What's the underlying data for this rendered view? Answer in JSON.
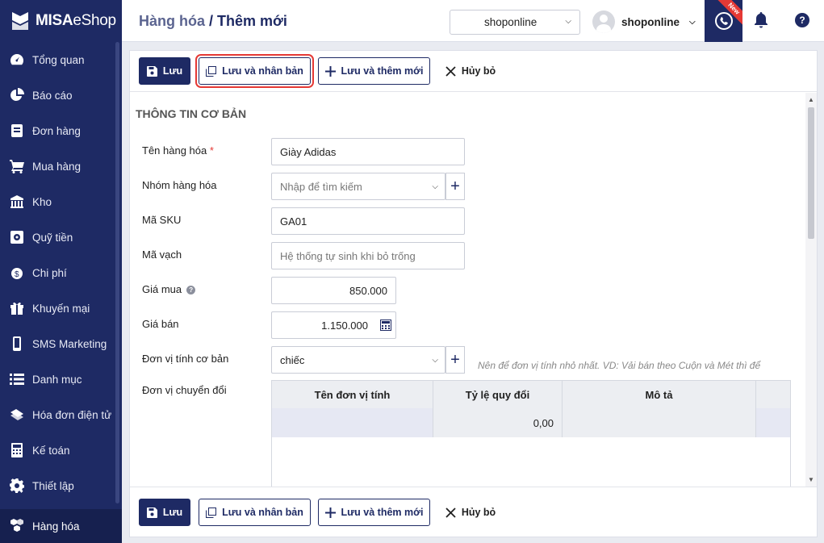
{
  "brand": {
    "logo_main": "MISA",
    "logo_sub": "eShop"
  },
  "sidebar": {
    "items": [
      {
        "label": "Tổng quan",
        "icon": "dashboard-icon"
      },
      {
        "label": "Báo cáo",
        "icon": "pie-chart-icon"
      },
      {
        "label": "Đơn hàng",
        "icon": "order-icon"
      },
      {
        "label": "Mua hàng",
        "icon": "cart-icon"
      },
      {
        "label": "Kho",
        "icon": "warehouse-icon"
      },
      {
        "label": "Quỹ tiền",
        "icon": "safe-icon"
      },
      {
        "label": "Chi phí",
        "icon": "money-icon"
      },
      {
        "label": "Khuyến mại",
        "icon": "gift-icon"
      },
      {
        "label": "SMS Marketing",
        "icon": "phone-device-icon"
      },
      {
        "label": "Danh mục",
        "icon": "list-icon"
      },
      {
        "label": "Hóa đơn điện tử",
        "icon": "invoice-icon"
      },
      {
        "label": "Kế toán",
        "icon": "calculator-icon"
      },
      {
        "label": "Thiết lập",
        "icon": "gear-icon"
      }
    ],
    "active": {
      "label": "Hàng hóa",
      "icon": "boxes-icon"
    }
  },
  "header": {
    "breadcrumb_parent": "Hàng hóa",
    "breadcrumb_sep": " / ",
    "breadcrumb_current": "Thêm mới",
    "shop": "shoponline",
    "user": "shoponline",
    "new_badge": "New",
    "help": "?"
  },
  "toolbar": {
    "save": "Lưu",
    "save_duplicate": "Lưu và nhân bản",
    "save_add_new": "Lưu và thêm mới",
    "cancel": "Hủy bỏ"
  },
  "form": {
    "section_title": "THÔNG TIN CƠ BẢN",
    "name_label": "Tên hàng hóa",
    "name_required": "*",
    "name_value": "Giày Adidas",
    "group_label": "Nhóm hàng hóa",
    "group_placeholder": "Nhập để tìm kiếm",
    "sku_label": "Mã SKU",
    "sku_value": "GA01",
    "barcode_label": "Mã vạch",
    "barcode_placeholder": "Hệ thống tự sinh khi bỏ trống",
    "buy_price_label": "Giá mua",
    "buy_price_value": "850.000",
    "sell_price_label": "Giá bán",
    "sell_price_value": "1.150.000",
    "unit_label": "Đơn vị tính cơ bản",
    "unit_value": "chiếc",
    "unit_hint": "Nên để đơn vị tính nhỏ nhất. VD: Vải bán theo Cuộn và Mét thì để",
    "conversion_label": "Đơn vị chuyển đổi"
  },
  "conversion_table": {
    "columns": [
      "Tên đơn vị tính",
      "Tỷ lệ quy đổi",
      "Mô tả"
    ],
    "rows": [
      {
        "unit": "",
        "ratio": "0,00",
        "desc": ""
      }
    ]
  }
}
